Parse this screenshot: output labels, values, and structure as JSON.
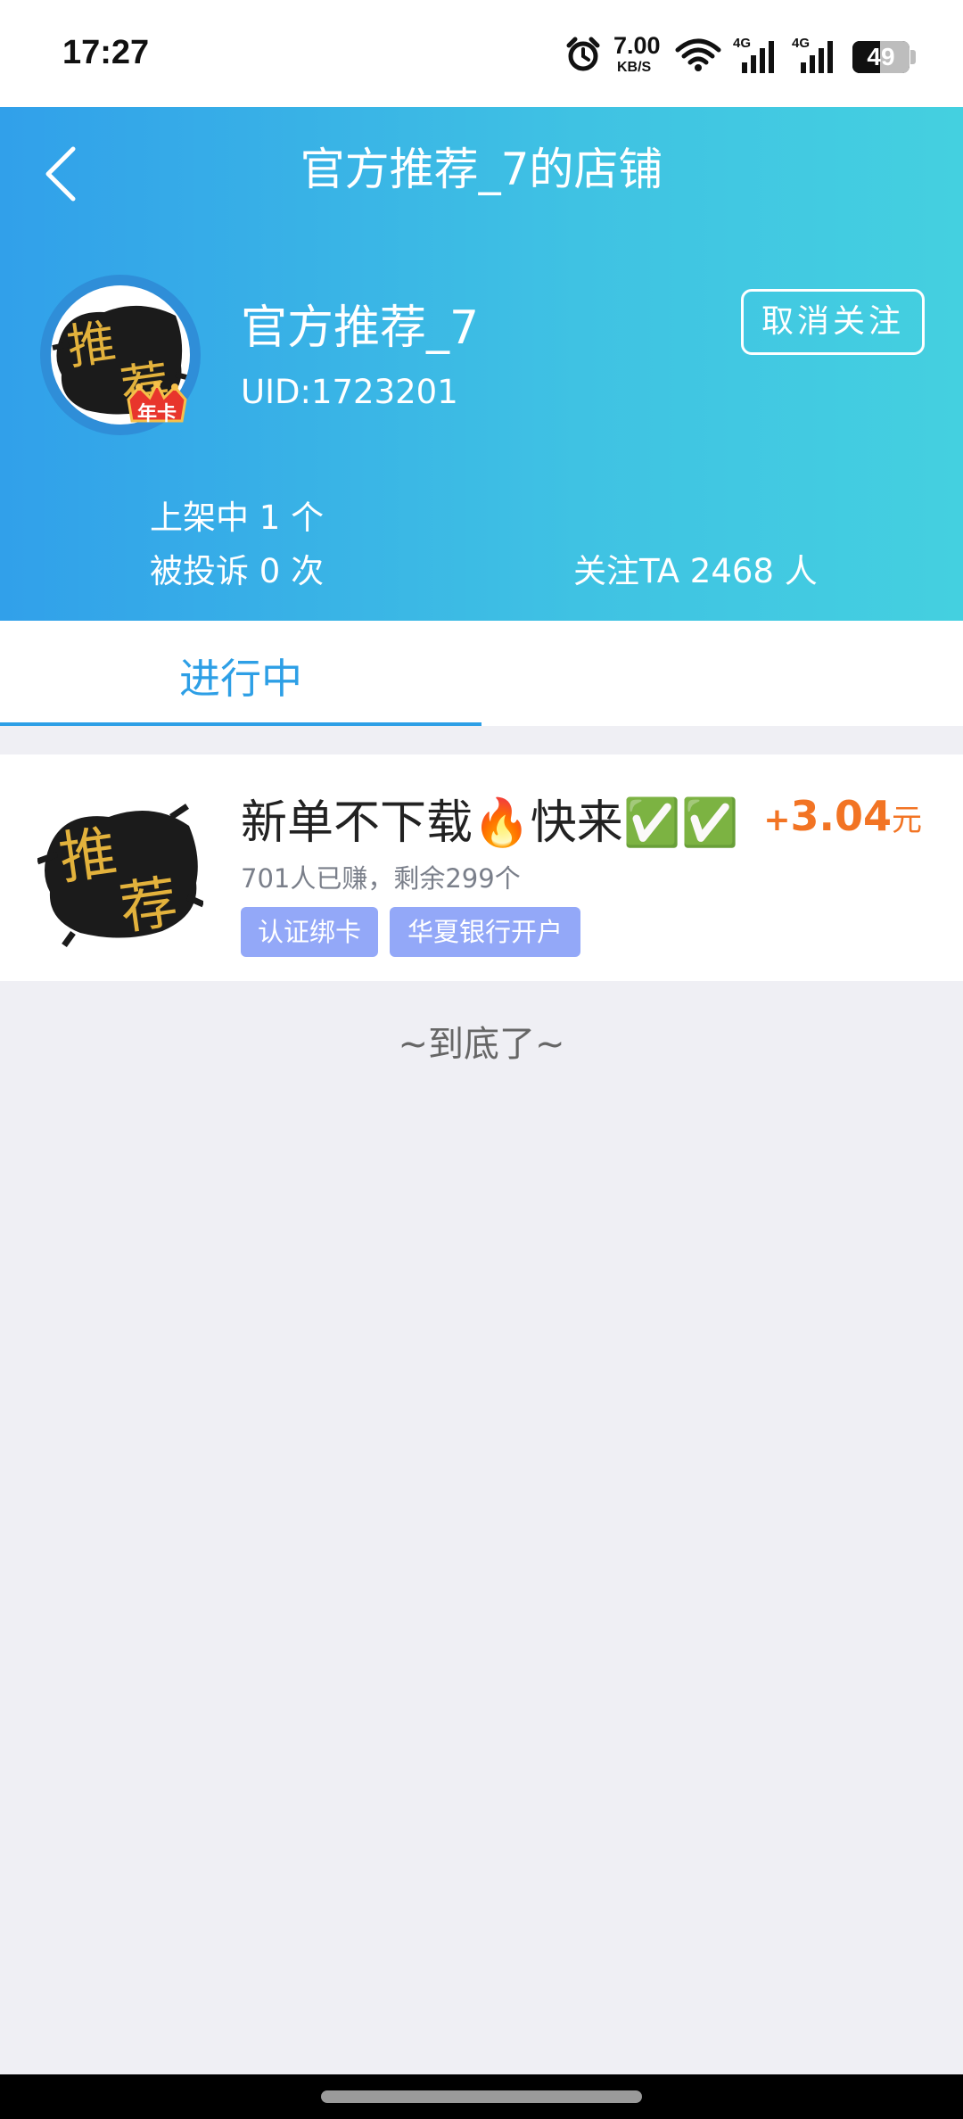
{
  "status_bar": {
    "time": "17:27",
    "net_speed": "7.00",
    "net_speed_unit": "KB/S",
    "signal_1_label": "4G",
    "signal_2_label": "4G",
    "battery": "49",
    "battery_level": 0.49
  },
  "header": {
    "title": "官方推荐_7的店铺",
    "shop_name": "官方推荐_7",
    "uid": "UID:1723201",
    "unfollow_label": "取消关注",
    "avatar_text_1": "推",
    "avatar_text_2": "荐",
    "badge_text": "年卡",
    "stats": {
      "listed": "上架中 1 个",
      "complaints": "被投诉 0 次",
      "followers": "关注TA 2468 人"
    }
  },
  "tabs": [
    {
      "label": "进行中",
      "active": true
    }
  ],
  "tasks": [
    {
      "title": "新单不下载🔥快来✅✅",
      "reward_sign": "+",
      "reward_value": "3.04",
      "reward_unit": "元",
      "subtitle": "701人已赚，剩余299个",
      "thumb_text_1": "推",
      "thumb_text_2": "荐",
      "tags": [
        "认证绑卡",
        "华夏银行开户"
      ]
    }
  ],
  "end_text": "~到底了~",
  "colors": {
    "header_gradient_start": "#31a0ea",
    "header_gradient_end": "#44d0e0",
    "tab_active": "#2d9fe6",
    "reward": "#f27424",
    "tag_bg": "#93a8f8",
    "page_bg": "#efeff4"
  },
  "icons": {
    "back": "chevron-left-icon",
    "alarm": "alarm-clock-icon",
    "wifi": "wifi-icon",
    "signal": "cell-signal-icon",
    "battery": "battery-icon"
  }
}
